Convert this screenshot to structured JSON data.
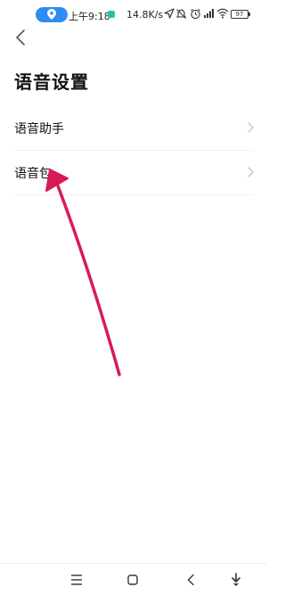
{
  "status_bar": {
    "time": "上午9:18",
    "net_speed": "14.8K/s",
    "battery": "97",
    "icons": [
      "location-icon",
      "navigation-arrow-icon",
      "mute-icon",
      "alarm-icon",
      "signal-icon",
      "wifi-icon",
      "battery-icon"
    ]
  },
  "header": {
    "back_icon": "back-chevron-icon",
    "title": "语音设置"
  },
  "settings": {
    "items": [
      {
        "label": "语音助手",
        "icon": "chevron-right-icon"
      },
      {
        "label": "语音包",
        "icon": "chevron-right-icon"
      }
    ]
  },
  "annotation": {
    "arrow_color": "#d81b55"
  },
  "nav_bar": {
    "buttons": [
      "menu-icon",
      "home-icon",
      "back-icon",
      "assist-icon"
    ]
  }
}
